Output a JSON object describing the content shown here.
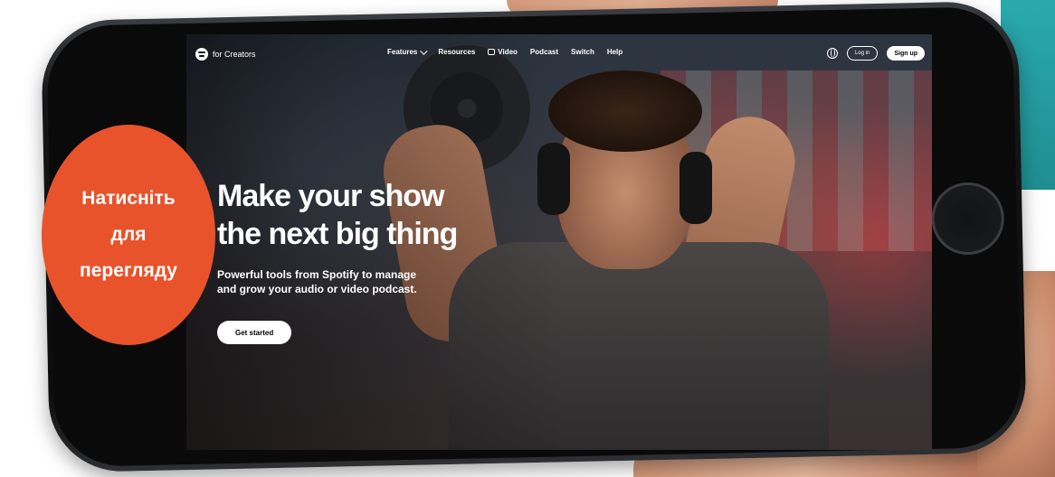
{
  "header": {
    "brand": "for Creators",
    "nav": [
      "Features",
      "Resources",
      "Video",
      "Podcast",
      "Switch",
      "Help"
    ],
    "login_label": "Log in",
    "signup_label": "Sign up"
  },
  "hero": {
    "title_line1": "Make your show",
    "title_line2": "the next big thing",
    "subtitle_line1": "Powerful tools from Spotify to manage",
    "subtitle_line2": "and grow your audio or video podcast.",
    "cta_label": "Get started"
  },
  "badge": {
    "lines": [
      "Натисніть",
      "для",
      "перегляду"
    ],
    "color": "#e8532b"
  },
  "colors": {
    "badge": "#e8532b",
    "phone_frame": "#141516",
    "teal_accent": "#2aa9ad"
  }
}
